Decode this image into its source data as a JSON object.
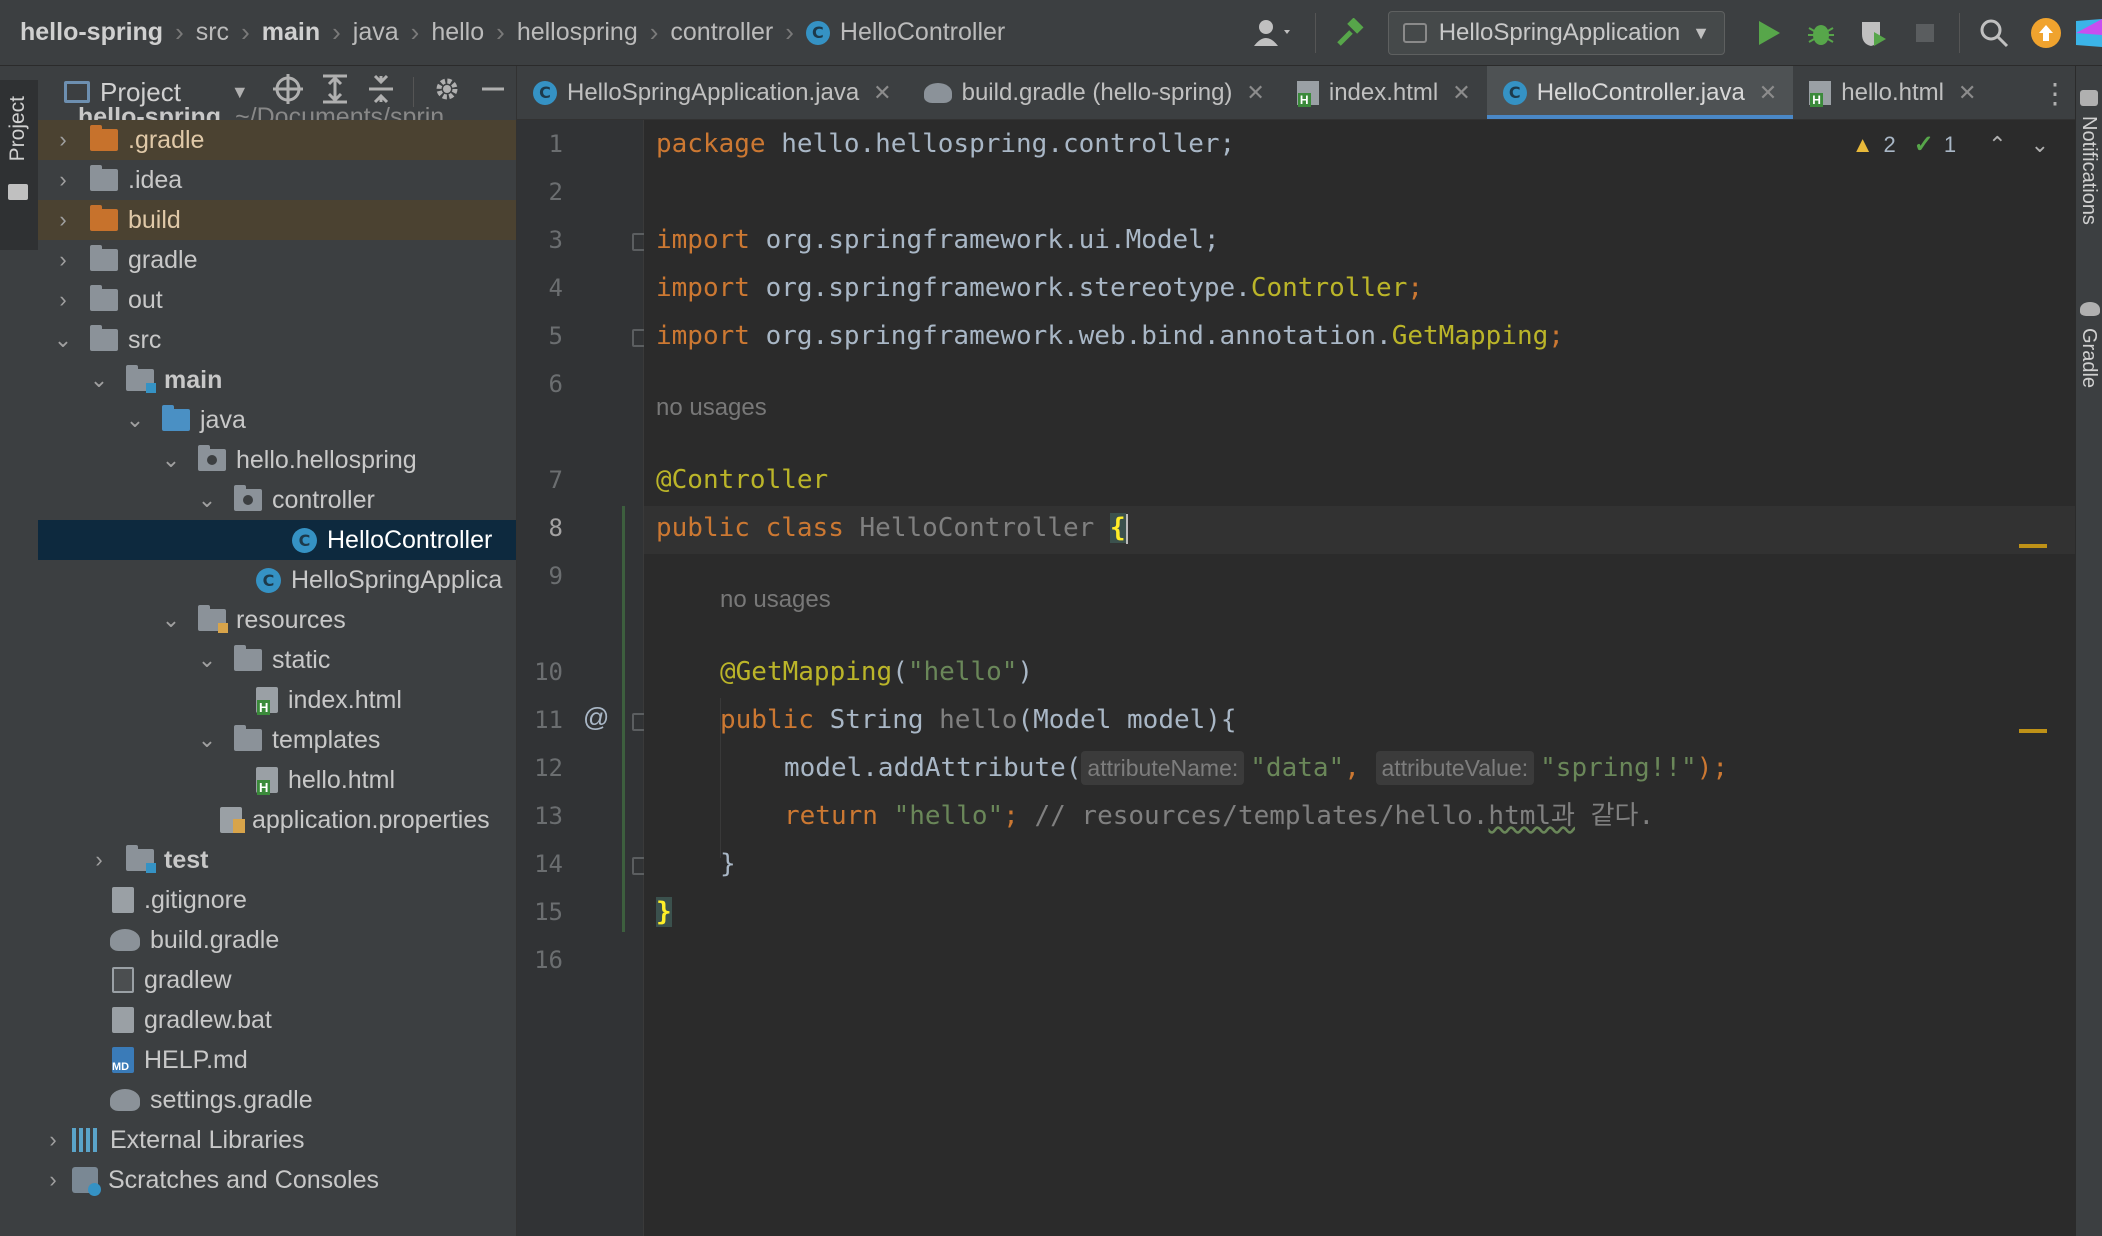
{
  "breadcrumbs": [
    "hello-spring",
    "src",
    "main",
    "java",
    "hello",
    "hellospring",
    "controller",
    "HelloController"
  ],
  "toolbar": {
    "run_config": "HelloSpringApplication"
  },
  "left_stripe": {
    "project_label": "Project"
  },
  "project_panel": {
    "title": "Project",
    "root_partial": "hello-spring",
    "root_path_partial": "~/Documents/sprin",
    "items": [
      {
        "label": ".gradle"
      },
      {
        "label": ".idea"
      },
      {
        "label": "build"
      },
      {
        "label": "gradle"
      },
      {
        "label": "out"
      },
      {
        "label": "src"
      },
      {
        "label": "main"
      },
      {
        "label": "java"
      },
      {
        "label": "hello.hellospring"
      },
      {
        "label": "controller"
      },
      {
        "label": "HelloController"
      },
      {
        "label": "HelloSpringApplica"
      },
      {
        "label": "resources"
      },
      {
        "label": "static"
      },
      {
        "label": "index.html"
      },
      {
        "label": "templates"
      },
      {
        "label": "hello.html"
      },
      {
        "label": "application.properties"
      },
      {
        "label": "test"
      },
      {
        "label": ".gitignore"
      },
      {
        "label": "build.gradle"
      },
      {
        "label": "gradlew"
      },
      {
        "label": "gradlew.bat"
      },
      {
        "label": "HELP.md"
      },
      {
        "label": "settings.gradle"
      },
      {
        "label": "External Libraries"
      },
      {
        "label": "Scratches and Consoles"
      }
    ]
  },
  "tabs": [
    {
      "label": "HelloSpringApplication.java"
    },
    {
      "label": "build.gradle (hello-spring)"
    },
    {
      "label": "index.html"
    },
    {
      "label": "HelloController.java"
    },
    {
      "label": "hello.html"
    }
  ],
  "inspections": {
    "warnings": "2",
    "ok": "1"
  },
  "editor": {
    "line_numbers": [
      "1",
      "2",
      "3",
      "4",
      "5",
      "6",
      "7",
      "8",
      "9",
      "10",
      "11",
      "12",
      "13",
      "14",
      "15",
      "16"
    ],
    "usage_hint": "no usages",
    "line1": {
      "kw": "package",
      "rest": " hello.hellospring.controller;"
    },
    "line3": {
      "kw": "import",
      "rest": " org.springframework.ui.Model;"
    },
    "line4": {
      "kw": "import",
      "rest": " org.springframework.stereotype.",
      "ann": "Controller",
      "end": ";"
    },
    "line5": {
      "kw": "import",
      "rest": " org.springframework.web.bind.annotation.",
      "ann": "GetMapping",
      "end": ";"
    },
    "line7": {
      "ann": "@Controller"
    },
    "line8": {
      "kw1": "public",
      "kw2": "class",
      "name": "HelloController",
      "brace": "{"
    },
    "line10": {
      "ann": "@GetMapping",
      "open": "(",
      "str": "\"hello\"",
      "close": ")"
    },
    "line11": {
      "kw": "public",
      "type": " String ",
      "name": "hello",
      "rest": "(Model model){"
    },
    "line12": {
      "call": "model.addAttribute(",
      "hint1": "attributeName:",
      "str1": "\"data\"",
      "comma": ",",
      "hint2": "attributeValue:",
      "str2": "\"spring!!\"",
      "end": ");"
    },
    "line13": {
      "kw": "return",
      "str": " \"hello\"",
      "semi": ";",
      "cmt1": " // resources/templates/hello.",
      "cmt_sq": "html과",
      "cmt2": " 같다."
    },
    "line14": {
      "text": "}"
    },
    "line15": {
      "brace": "}"
    }
  },
  "right_stripe": {
    "notifications": "Notifications",
    "gradle": "Gradle"
  },
  "colors": {
    "accent": "#4a88c7",
    "keyword": "#cc7832",
    "annotation": "#bbb529",
    "string": "#6a8759",
    "warning": "#e8b93a",
    "run": "#57a64a"
  }
}
